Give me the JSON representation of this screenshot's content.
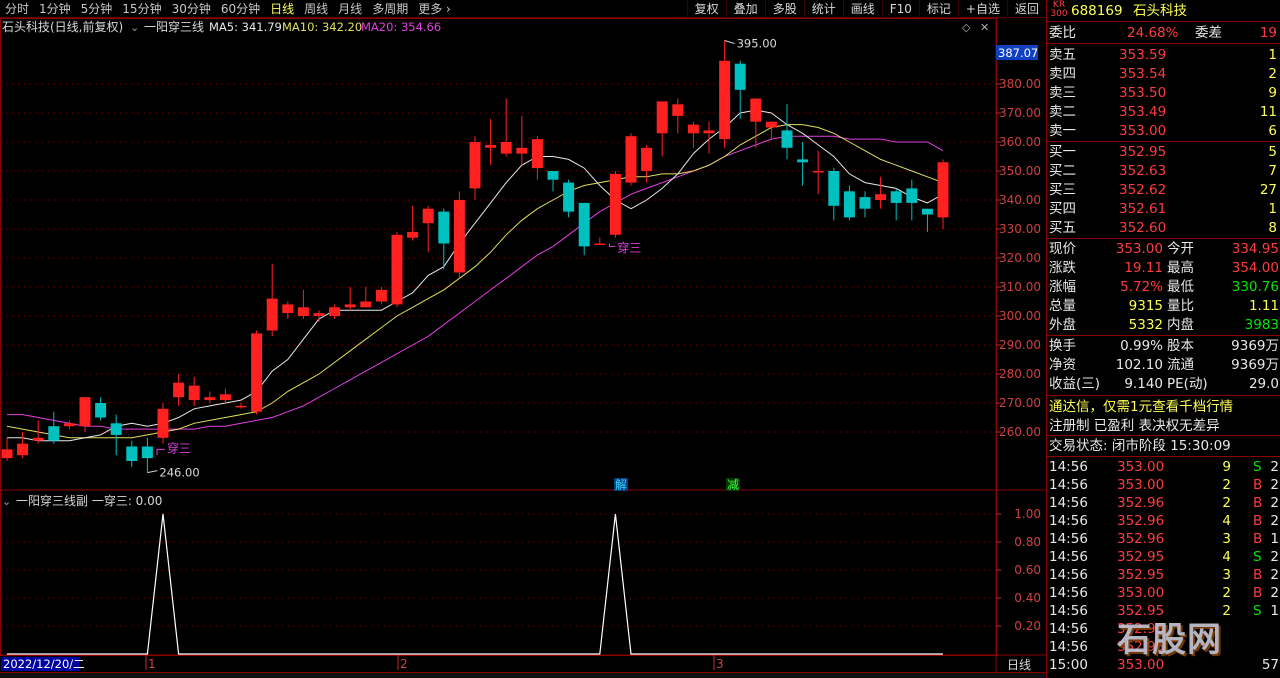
{
  "periods": [
    "分时",
    "1分钟",
    "5分钟",
    "15分钟",
    "30分钟",
    "60分钟",
    "日线",
    "周线",
    "月线",
    "多周期",
    "更多 ›"
  ],
  "active_period": "日线",
  "toolbar": [
    "复权",
    "叠加",
    "多股",
    "统计",
    "画线",
    "F10",
    "标记",
    "+自选",
    "返回"
  ],
  "header": {
    "title": "石头科技(日线,前复权)",
    "indicator": "一阳穿三线",
    "ma5": "MA5: 341.79",
    "ma10": "MA10: 342.20",
    "ma20": "MA20: 354.66"
  },
  "sub_header": "一阳穿三线副 一穿三: 0.00",
  "current_price_label": "387.07",
  "bottom_left_date": "2022/12/20/二",
  "bottom_months": [
    "1",
    "2",
    "3"
  ],
  "bottom_right": "日线",
  "annotations": {
    "high": "395.00",
    "low": "246.00",
    "cross1": "穿三",
    "cross2": "穿三",
    "jie": "解",
    "jian": "减"
  },
  "colors": {
    "up": "#ff2020",
    "down": "#00c0c0",
    "ma5": "#e8e8e8",
    "ma10": "#e0e060",
    "ma20": "#e040e0",
    "grid": "#8b0000"
  },
  "chart_data": {
    "type": "candlestick",
    "title": "石头科技(日线,前复权)",
    "ylim": [
      246,
      395
    ],
    "yticks": [
      260,
      270,
      280,
      290,
      300,
      310,
      320,
      330,
      340,
      350,
      360,
      370,
      380
    ],
    "candles": [
      {
        "o": 251,
        "c": 254,
        "h": 258,
        "l": 250
      },
      {
        "o": 252,
        "c": 256,
        "h": 260,
        "l": 251
      },
      {
        "o": 257,
        "c": 258,
        "h": 264,
        "l": 256
      },
      {
        "o": 262,
        "c": 257,
        "h": 267,
        "l": 256
      },
      {
        "o": 262,
        "c": 263,
        "h": 264,
        "l": 261
      },
      {
        "o": 262,
        "c": 272,
        "h": 272,
        "l": 260
      },
      {
        "o": 270,
        "c": 265,
        "h": 272,
        "l": 264
      },
      {
        "o": 263,
        "c": 259,
        "h": 266,
        "l": 252
      },
      {
        "o": 255,
        "c": 250,
        "h": 257,
        "l": 248
      },
      {
        "o": 255,
        "c": 251,
        "h": 258,
        "l": 246
      },
      {
        "o": 258,
        "c": 268,
        "h": 270,
        "l": 256
      },
      {
        "o": 272,
        "c": 277,
        "h": 280,
        "l": 269
      },
      {
        "o": 271,
        "c": 276,
        "h": 279,
        "l": 269
      },
      {
        "o": 271,
        "c": 272,
        "h": 274,
        "l": 270
      },
      {
        "o": 271,
        "c": 273,
        "h": 275,
        "l": 270
      },
      {
        "o": 269,
        "c": 269,
        "h": 270,
        "l": 268
      },
      {
        "o": 267,
        "c": 294,
        "h": 295,
        "l": 266
      },
      {
        "o": 295,
        "c": 306,
        "h": 318,
        "l": 293
      },
      {
        "o": 301,
        "c": 304,
        "h": 305,
        "l": 299
      },
      {
        "o": 300,
        "c": 303,
        "h": 309,
        "l": 299
      },
      {
        "o": 300,
        "c": 301,
        "h": 302,
        "l": 298
      },
      {
        "o": 300,
        "c": 303,
        "h": 304,
        "l": 299
      },
      {
        "o": 303,
        "c": 304,
        "h": 310,
        "l": 302
      },
      {
        "o": 303,
        "c": 305,
        "h": 310,
        "l": 303
      },
      {
        "o": 305,
        "c": 309,
        "h": 310,
        "l": 304
      },
      {
        "o": 304,
        "c": 328,
        "h": 329,
        "l": 303
      },
      {
        "o": 327,
        "c": 329,
        "h": 338,
        "l": 326
      },
      {
        "o": 332,
        "c": 337,
        "h": 338,
        "l": 322
      },
      {
        "o": 336,
        "c": 325,
        "h": 337,
        "l": 316
      },
      {
        "o": 315,
        "c": 340,
        "h": 343,
        "l": 313
      },
      {
        "o": 344,
        "c": 360,
        "h": 362,
        "l": 340
      },
      {
        "o": 358,
        "c": 359,
        "h": 368,
        "l": 352
      },
      {
        "o": 356,
        "c": 360,
        "h": 375,
        "l": 355
      },
      {
        "o": 356,
        "c": 358,
        "h": 369,
        "l": 352
      },
      {
        "o": 351,
        "c": 361,
        "h": 362,
        "l": 347
      },
      {
        "o": 350,
        "c": 347,
        "h": 350,
        "l": 343
      },
      {
        "o": 346,
        "c": 336,
        "h": 347,
        "l": 334
      },
      {
        "o": 339,
        "c": 324,
        "h": 339,
        "l": 321
      },
      {
        "o": 325,
        "c": 325,
        "h": 327,
        "l": 325
      },
      {
        "o": 328,
        "c": 349,
        "h": 350,
        "l": 327
      },
      {
        "o": 346,
        "c": 362,
        "h": 363,
        "l": 345
      },
      {
        "o": 350,
        "c": 358,
        "h": 359,
        "l": 346
      },
      {
        "o": 363,
        "c": 374,
        "h": 374,
        "l": 355
      },
      {
        "o": 369,
        "c": 373,
        "h": 375,
        "l": 363
      },
      {
        "o": 363,
        "c": 366,
        "h": 367,
        "l": 358
      },
      {
        "o": 363,
        "c": 364,
        "h": 367,
        "l": 356
      },
      {
        "o": 361,
        "c": 388,
        "h": 395,
        "l": 358
      },
      {
        "o": 387,
        "c": 378,
        "h": 388,
        "l": 368
      },
      {
        "o": 367,
        "c": 375,
        "h": 375,
        "l": 358
      },
      {
        "o": 365,
        "c": 367,
        "h": 367,
        "l": 361
      },
      {
        "o": 364,
        "c": 358,
        "h": 373,
        "l": 354
      },
      {
        "o": 354,
        "c": 353,
        "h": 360,
        "l": 345
      },
      {
        "o": 350,
        "c": 350,
        "h": 357,
        "l": 342
      },
      {
        "o": 350,
        "c": 338,
        "h": 351,
        "l": 333
      },
      {
        "o": 343,
        "c": 334,
        "h": 345,
        "l": 333
      },
      {
        "o": 341,
        "c": 337,
        "h": 343,
        "l": 334
      },
      {
        "o": 340,
        "c": 342,
        "h": 348,
        "l": 337
      },
      {
        "o": 343,
        "c": 339,
        "h": 344,
        "l": 333
      },
      {
        "o": 344,
        "c": 339,
        "h": 347,
        "l": 333
      },
      {
        "o": 337,
        "c": 335,
        "h": 337,
        "l": 329
      },
      {
        "o": 334,
        "c": 353,
        "h": 354,
        "l": 330
      }
    ],
    "ma5": [
      258,
      258,
      257,
      257,
      257,
      258,
      259,
      262,
      263,
      262,
      263,
      265,
      268,
      269,
      270,
      271,
      274,
      281,
      285,
      292,
      299,
      302,
      302,
      302,
      302,
      305,
      308,
      314,
      317,
      325,
      332,
      339,
      346,
      352,
      355,
      355,
      354,
      351,
      345,
      340,
      337,
      340,
      344,
      349,
      356,
      361,
      365,
      370,
      371,
      370,
      366,
      363,
      359,
      355,
      349,
      346,
      345,
      344,
      341,
      339,
      342
    ],
    "ma10": [
      262,
      261,
      260,
      259,
      258,
      258,
      258,
      258,
      258,
      259,
      260,
      261,
      263,
      264,
      265,
      266,
      267,
      270,
      274,
      277,
      280,
      284,
      288,
      292,
      296,
      300,
      303,
      306,
      309,
      313,
      317,
      322,
      328,
      333,
      337,
      340,
      343,
      345,
      346,
      347,
      348,
      348,
      349,
      349,
      350,
      352,
      355,
      359,
      362,
      365,
      366,
      366,
      365,
      363,
      360,
      357,
      354,
      352,
      350,
      348,
      346
    ],
    "ma20": [
      266,
      266,
      265,
      264,
      263,
      262,
      262,
      261,
      261,
      261,
      261,
      261,
      261,
      262,
      262,
      263,
      264,
      265,
      267,
      269,
      272,
      275,
      278,
      281,
      284,
      287,
      290,
      293,
      297,
      301,
      305,
      309,
      313,
      317,
      321,
      324,
      328,
      332,
      336,
      339,
      342,
      344,
      346,
      348,
      350,
      352,
      355,
      357,
      359,
      361,
      362,
      362,
      362,
      362,
      361,
      361,
      361,
      360,
      360,
      360,
      357
    ],
    "signal": {
      "ylim": [
        0,
        1.1
      ],
      "yticks": [
        0.2,
        0.4,
        0.6,
        0.8,
        1.0
      ],
      "ones_at": [
        10,
        39
      ]
    }
  },
  "quote": {
    "code": "688169",
    "name": "石头科技",
    "badge": "KR",
    "badge2": "300",
    "weibi_label": "委比",
    "weibi_val": "24.68%",
    "weicha_label": "委差",
    "weicha_val": "19",
    "asks": [
      {
        "label": "卖五",
        "price": "353.59",
        "vol": "1"
      },
      {
        "label": "卖四",
        "price": "353.54",
        "vol": "2"
      },
      {
        "label": "卖三",
        "price": "353.50",
        "vol": "9"
      },
      {
        "label": "卖二",
        "price": "353.49",
        "vol": "11"
      },
      {
        "label": "卖一",
        "price": "353.00",
        "vol": "6"
      }
    ],
    "bids": [
      {
        "label": "买一",
        "price": "352.95",
        "vol": "5"
      },
      {
        "label": "买二",
        "price": "352.63",
        "vol": "7"
      },
      {
        "label": "买三",
        "price": "352.62",
        "vol": "27"
      },
      {
        "label": "买四",
        "price": "352.61",
        "vol": "1"
      },
      {
        "label": "买五",
        "price": "352.60",
        "vol": "8"
      }
    ],
    "stats": [
      {
        "l1": "现价",
        "v1": "353.00",
        "l2": "今开",
        "v2": "334.95"
      },
      {
        "l1": "涨跌",
        "v1": "19.11",
        "l2": "最高",
        "v2": "354.00"
      },
      {
        "l1": "涨幅",
        "v1": "5.72%",
        "l2": "最低",
        "v2": "330.76"
      },
      {
        "l1": "总量",
        "v1": "9315",
        "l2": "量比",
        "v2": "1.11"
      },
      {
        "l1": "外盘",
        "v1": "5332",
        "l2": "内盘",
        "v2": "3983"
      }
    ],
    "stats2": [
      {
        "l1": "换手",
        "v1": "0.99%",
        "l2": "股本",
        "v2": "9369万"
      },
      {
        "l1": "净资",
        "v1": "102.10",
        "l2": "流通",
        "v2": "9369万"
      },
      {
        "l1": "收益(三)",
        "v1": "9.140",
        "l2": "PE(动)",
        "v2": "29.0"
      }
    ],
    "promo": "通达信，仅需1元查看千档行情",
    "register": "注册制 已盈利 表决权无差异",
    "trade_status": "交易状态: 闭市阶段 15:30:09",
    "ticks": [
      {
        "t": "14:56",
        "p": "353.00",
        "v": "9",
        "d": "S",
        "n": "2"
      },
      {
        "t": "14:56",
        "p": "353.00",
        "v": "2",
        "d": "B",
        "n": "2"
      },
      {
        "t": "14:56",
        "p": "352.96",
        "v": "2",
        "d": "B",
        "n": "2"
      },
      {
        "t": "14:56",
        "p": "352.96",
        "v": "4",
        "d": "B",
        "n": "2"
      },
      {
        "t": "14:56",
        "p": "352.96",
        "v": "3",
        "d": "B",
        "n": "1"
      },
      {
        "t": "14:56",
        "p": "352.95",
        "v": "4",
        "d": "S",
        "n": "2"
      },
      {
        "t": "14:56",
        "p": "352.95",
        "v": "3",
        "d": "B",
        "n": "2"
      },
      {
        "t": "14:56",
        "p": "353.00",
        "v": "2",
        "d": "B",
        "n": "2"
      },
      {
        "t": "14:56",
        "p": "352.95",
        "v": "2",
        "d": "S",
        "n": "1"
      },
      {
        "t": "14:56",
        "p": "352.95",
        "v": "",
        "d": "",
        "n": ""
      },
      {
        "t": "14:56",
        "p": "352.95",
        "v": "",
        "d": "",
        "n": ""
      },
      {
        "t": "15:00",
        "p": "353.00",
        "v": "",
        "d": "",
        "n": "57"
      }
    ],
    "watermark": "石股网"
  }
}
